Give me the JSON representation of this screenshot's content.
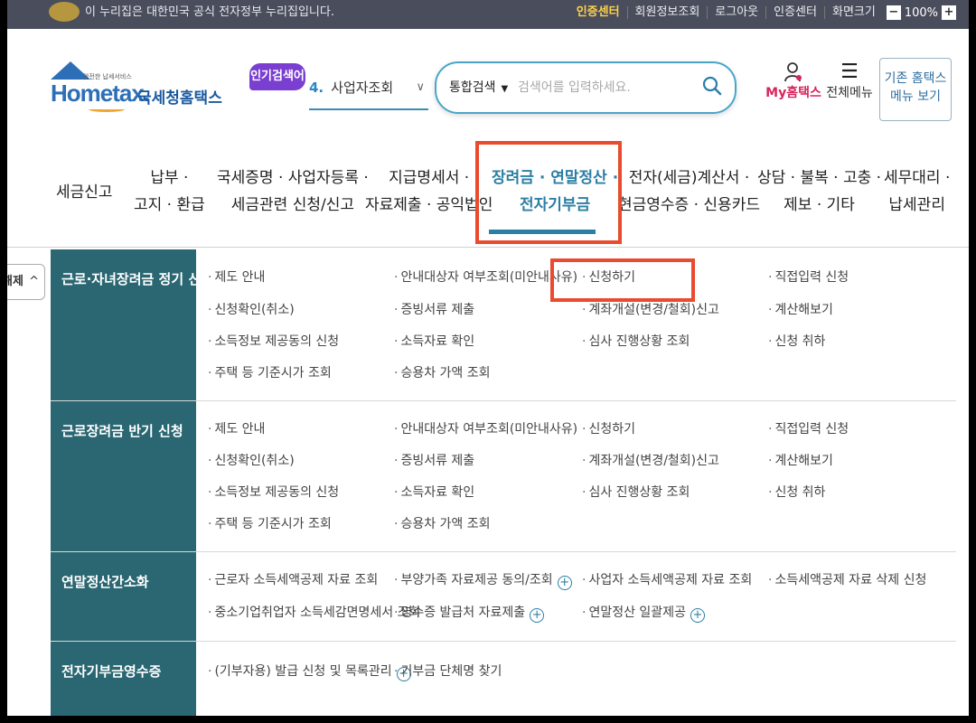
{
  "topbar": {
    "notice": "이 누리집은 대한민국 공식 전자정부 누리집입니다.",
    "links": [
      "인증센터",
      "회원정보조회",
      "로그아웃",
      "인증센터",
      "화면크기"
    ],
    "zoom_minus": "−",
    "zoom_value": "100%",
    "zoom_plus": "+"
  },
  "header": {
    "logo_sub": "안전한 납세서비스",
    "logo_brand": "Hometax.",
    "logo_kr": "국세청홈택스",
    "popular_tag": "인기검색어",
    "popular_rank": "4.",
    "popular_text": "사업자조회",
    "search_scope": "통합검색",
    "search_placeholder": "검색어를 입력하세요.",
    "my_hometax": "My홈택스",
    "all_menu": "전체메뉴",
    "old_site_line1": "기존 홈택스",
    "old_site_line2": "메뉴 보기"
  },
  "gnb": [
    {
      "l1": "세금신고",
      "l2": ""
    },
    {
      "l1": "납부 ·",
      "l2": "고지 · 환급"
    },
    {
      "l1": "국세증명 · 사업자등록 ·",
      "l2": "세금관련 신청/신고"
    },
    {
      "l1": "지급명세서 ·",
      "l2": "자료제출 · 공익법인"
    },
    {
      "l1": "장려금 · 연말정산 ·",
      "l2": "전자기부금"
    },
    {
      "l1": "전자(세금)계산서 ·",
      "l2": "현금영수증 · 신용카드"
    },
    {
      "l1": "상담 · 불복 · 고충 ·",
      "l2": "제보 · 기타"
    },
    {
      "l1": "세무대리 ·",
      "l2": "납세관리"
    }
  ],
  "collapse_tab": {
    "label": "해제",
    "chevron": "^"
  },
  "sections": [
    {
      "category": "근로·자녀장려금 정기 신청",
      "links": [
        "제도 안내",
        "안내대상자 여부조회(미안내사유)",
        "신청하기",
        "직접입력 신청",
        "신청확인(취소)",
        "증빙서류 제출",
        "계좌개설(변경/철회)신고",
        "계산해보기",
        "소득정보 제공동의 신청",
        "소득자료 확인",
        "심사 진행상황 조회",
        "신청 취하",
        "주택 등 기준시가 조회",
        "승용차 가액 조회"
      ]
    },
    {
      "category": "근로장려금 반기 신청",
      "links": [
        "제도 안내",
        "안내대상자 여부조회(미안내사유)",
        "신청하기",
        "직접입력 신청",
        "신청확인(취소)",
        "증빙서류 제출",
        "계좌개설(변경/철회)신고",
        "계산해보기",
        "소득정보 제공동의 신청",
        "소득자료 확인",
        "심사 진행상황 조회",
        "신청 취하",
        "주택 등 기준시가 조회",
        "승용차 가액 조회"
      ]
    },
    {
      "category": "연말정산간소화",
      "links": [
        "근로자 소득세액공제 자료 조회",
        "부양가족 자료제공 동의/조회",
        "사업자 소득세액공제 자료 조회",
        "소득세액공제 자료 삭제 신청",
        "중소기업취업자 소득세감면명세서 조회",
        "영수증 발급처 자료제출",
        "연말정산 일괄제공"
      ]
    },
    {
      "category": "전자기부금영수증",
      "links": [
        "(기부자용) 발급 신청 및 목록관리",
        "기부금 단체명 찾기"
      ]
    }
  ],
  "colors": {
    "accent": "#2c7fa4",
    "category_bg": "#2a6772",
    "highlight_box": "#ea4a2e",
    "topbar_bg": "#4a4d5c"
  }
}
